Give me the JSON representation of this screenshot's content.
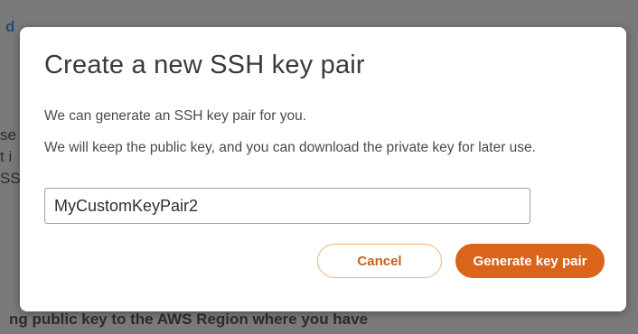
{
  "background": {
    "link_fragment": "d",
    "fragment_1": "se",
    "fragment_2": "t i",
    "fragment_3": "SS",
    "bottom_text": "ng public key to the AWS Region where you have"
  },
  "modal": {
    "title": "Create a new SSH key pair",
    "text_1": "We can generate an SSH key pair for you.",
    "text_2": "We will keep the public key, and you can download the private key for later use.",
    "key_name_value": "MyCustomKeyPair2",
    "cancel_label": "Cancel",
    "generate_label": "Generate key pair"
  },
  "colors": {
    "accent": "#d9641a",
    "cancel_border": "#f0b571",
    "cancel_text": "#c8621b",
    "overlay": "#7a7a7a"
  }
}
